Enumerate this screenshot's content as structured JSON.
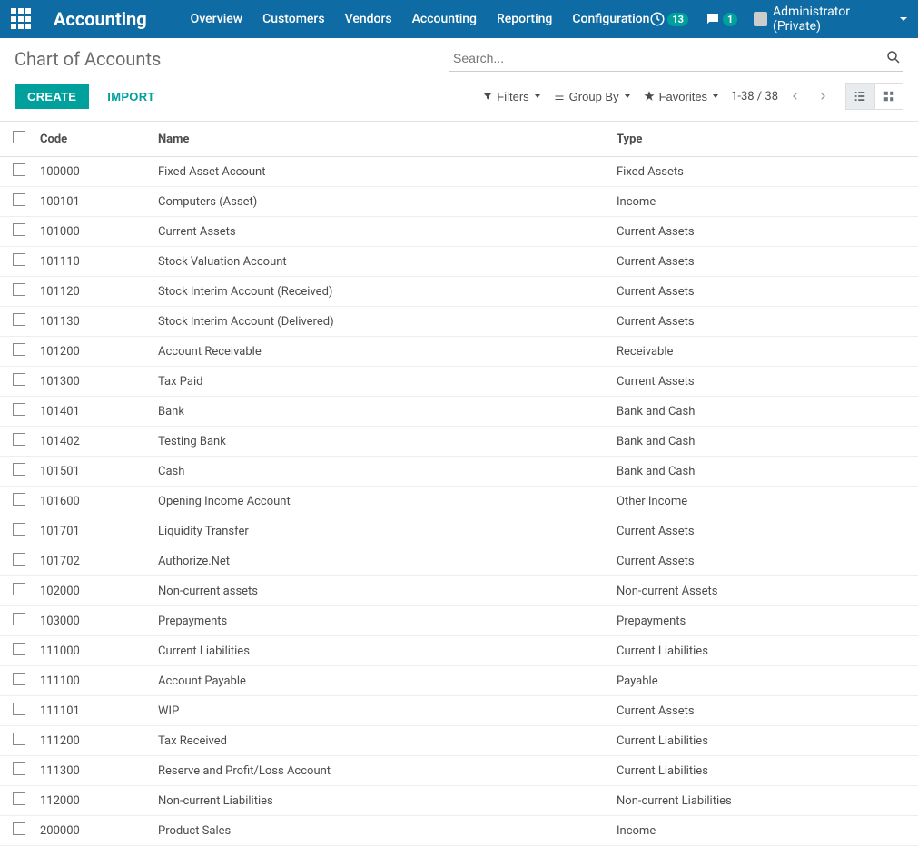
{
  "app": {
    "title": "Accounting"
  },
  "nav": {
    "items": [
      {
        "label": "Overview"
      },
      {
        "label": "Customers"
      },
      {
        "label": "Vendors"
      },
      {
        "label": "Accounting"
      },
      {
        "label": "Reporting"
      },
      {
        "label": "Configuration"
      }
    ]
  },
  "topbar": {
    "activity_count": "13",
    "message_count": "1",
    "user_label": "Administrator (Private)"
  },
  "breadcrumb": {
    "title": "Chart of Accounts"
  },
  "search": {
    "placeholder": "Search..."
  },
  "actions": {
    "create": "CREATE",
    "import": "IMPORT"
  },
  "controls": {
    "filters": "Filters",
    "group_by": "Group By",
    "favorites": "Favorites",
    "pager": "1-38 / 38"
  },
  "table": {
    "headers": {
      "code": "Code",
      "name": "Name",
      "type": "Type"
    },
    "rows": [
      {
        "code": "100000",
        "name": "Fixed Asset Account",
        "type": "Fixed Assets"
      },
      {
        "code": "100101",
        "name": "Computers (Asset)",
        "type": "Income"
      },
      {
        "code": "101000",
        "name": "Current Assets",
        "type": "Current Assets"
      },
      {
        "code": "101110",
        "name": "Stock Valuation Account",
        "type": "Current Assets"
      },
      {
        "code": "101120",
        "name": "Stock Interim Account (Received)",
        "type": "Current Assets"
      },
      {
        "code": "101130",
        "name": "Stock Interim Account (Delivered)",
        "type": "Current Assets"
      },
      {
        "code": "101200",
        "name": "Account Receivable",
        "type": "Receivable"
      },
      {
        "code": "101300",
        "name": "Tax Paid",
        "type": "Current Assets"
      },
      {
        "code": "101401",
        "name": "Bank",
        "type": "Bank and Cash"
      },
      {
        "code": "101402",
        "name": "Testing Bank",
        "type": "Bank and Cash"
      },
      {
        "code": "101501",
        "name": "Cash",
        "type": "Bank and Cash"
      },
      {
        "code": "101600",
        "name": "Opening Income Account",
        "type": "Other Income"
      },
      {
        "code": "101701",
        "name": "Liquidity Transfer",
        "type": "Current Assets"
      },
      {
        "code": "101702",
        "name": "Authorize.Net",
        "type": "Current Assets"
      },
      {
        "code": "102000",
        "name": "Non-current assets",
        "type": "Non-current Assets"
      },
      {
        "code": "103000",
        "name": "Prepayments",
        "type": "Prepayments"
      },
      {
        "code": "111000",
        "name": "Current Liabilities",
        "type": "Current Liabilities"
      },
      {
        "code": "111100",
        "name": "Account Payable",
        "type": "Payable"
      },
      {
        "code": "111101",
        "name": "WIP",
        "type": "Current Assets"
      },
      {
        "code": "111200",
        "name": "Tax Received",
        "type": "Current Liabilities"
      },
      {
        "code": "111300",
        "name": "Reserve and Profit/Loss Account",
        "type": "Current Liabilities"
      },
      {
        "code": "112000",
        "name": "Non-current Liabilities",
        "type": "Non-current Liabilities"
      },
      {
        "code": "200000",
        "name": "Product Sales",
        "type": "Income"
      }
    ]
  }
}
